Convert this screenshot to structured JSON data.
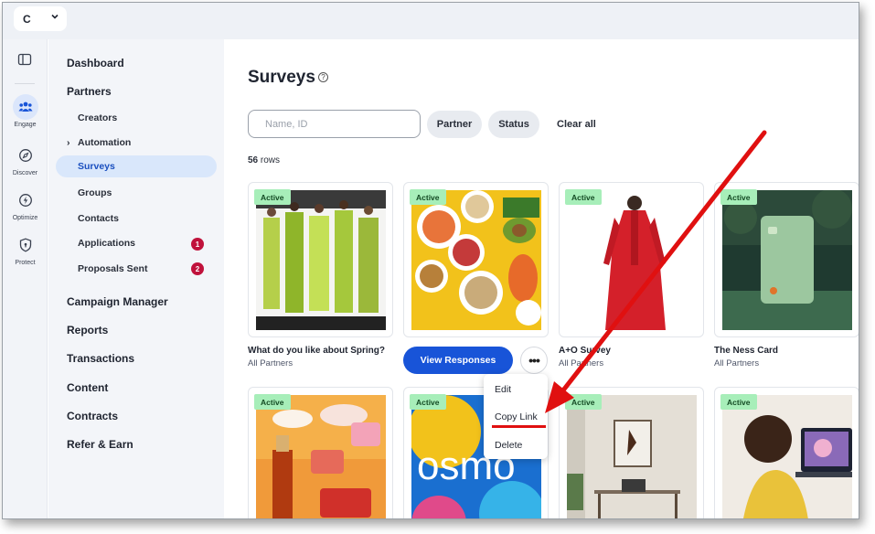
{
  "workspace": {
    "label": "C"
  },
  "rail": [
    {
      "label": "Engage",
      "icon": "people-icon"
    },
    {
      "label": "Discover",
      "icon": "compass-icon"
    },
    {
      "label": "Optimize",
      "icon": "bolt-icon"
    },
    {
      "label": "Protect",
      "icon": "shield-icon"
    }
  ],
  "nav": {
    "dashboard": "Dashboard",
    "partners": "Partners",
    "creators": "Creators",
    "automation": "Automation",
    "surveys": "Surveys",
    "groups": "Groups",
    "contacts": "Contacts",
    "applications": "Applications",
    "applications_count": "1",
    "proposals": "Proposals Sent",
    "proposals_count": "2",
    "campaign_manager": "Campaign Manager",
    "reports": "Reports",
    "transactions": "Transactions",
    "content": "Content",
    "contracts": "Contracts",
    "refer": "Refer & Earn"
  },
  "page": {
    "title": "Surveys",
    "help": "?",
    "search_placeholder": "Name, ID",
    "filter_partner": "Partner",
    "filter_status": "Status",
    "clear_all": "Clear all",
    "row_count": "56",
    "row_unit": "rows"
  },
  "cards": [
    {
      "status": "Active",
      "title": "What do you like about Spring?",
      "subtitle": "All Partners"
    },
    {
      "status": "Active",
      "title": "",
      "subtitle": ""
    },
    {
      "status": "Active",
      "title": "A+O Survey",
      "subtitle": "All Partners"
    },
    {
      "status": "Active",
      "title": "The Ness Card",
      "subtitle": "All Partners"
    },
    {
      "status": "Active"
    },
    {
      "status": "Active",
      "logo_text": "osmo"
    },
    {
      "status": "Active"
    },
    {
      "status": "Active"
    }
  ],
  "actions": {
    "view_responses": "View Responses",
    "more": "•••"
  },
  "menu": {
    "edit": "Edit",
    "copy_link": "Copy Link",
    "delete": "Delete"
  },
  "colors": {
    "accent": "#1854d8",
    "active_tag": "#a7eeb9",
    "badge": "#c0123c",
    "annotation": "#e01010"
  }
}
